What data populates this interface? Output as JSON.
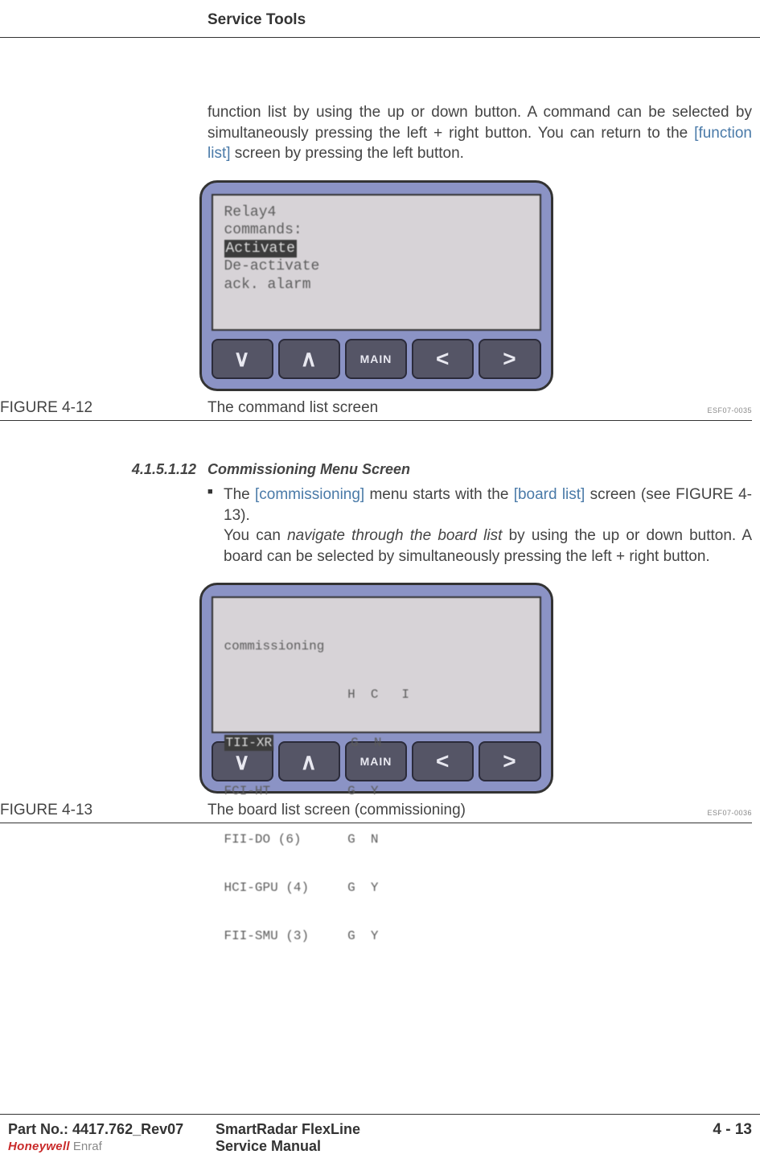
{
  "header": {
    "section_title": "Service Tools"
  },
  "intro": {
    "part1": "function list by using the up or down button. A command can be selected by simultaneously pressing the left + right button. You can return to the ",
    "link": "[function list]",
    "part2": " screen by pressing the left button."
  },
  "device1": {
    "screen": {
      "line1": "Relay4",
      "line2": "commands:",
      "line3_hl": "Activate",
      "line4": "De-activate",
      "line5": "ack. alarm"
    },
    "buttons": {
      "down": "∨",
      "up": "∧",
      "main": "MAIN",
      "left": "<",
      "right": ">"
    }
  },
  "figure1": {
    "label": "FIGURE  4-12",
    "caption": "The command list screen",
    "code": "ESF07-0035"
  },
  "subsection": {
    "number": "4.1.5.1.12",
    "title": "Commissioning Menu Screen"
  },
  "bullet": {
    "p1a": "The ",
    "p1link1": "[commissioning]",
    "p1b": " menu starts with the ",
    "p1link2": "[board list]",
    "p1c": " screen (see FIGURE 4-13).",
    "p2a": "You can ",
    "p2italic": "navigate through the board list",
    "p2b": " by using the up or down button. A board can be selected by simultaneously pressing the left + right button."
  },
  "device2": {
    "screen": {
      "header": "commissioning",
      "cols": "                H  C   I",
      "row1_hl": "TII-XR",
      "row1_rest": "          G  N",
      "row2": "FCI-HT          G  Y",
      "row3": "FII-DO (6)      G  N",
      "row4": "HCI-GPU (4)     G  Y",
      "row5": "FII-SMU (3)     G  Y"
    },
    "buttons": {
      "down": "∨",
      "up": "∧",
      "main": "MAIN",
      "left": "<",
      "right": ">"
    }
  },
  "figure2": {
    "label": "FIGURE  4-13",
    "caption": "The board list screen (commissioning)",
    "code": "ESF07-0036"
  },
  "footer": {
    "part_no": "Part No.: 4417.762_Rev07",
    "product": "SmartRadar FlexLine",
    "doc": "Service Manual",
    "page": "4 - 13",
    "brand_hw": "Honeywell",
    "brand_enraf": "Enraf"
  }
}
